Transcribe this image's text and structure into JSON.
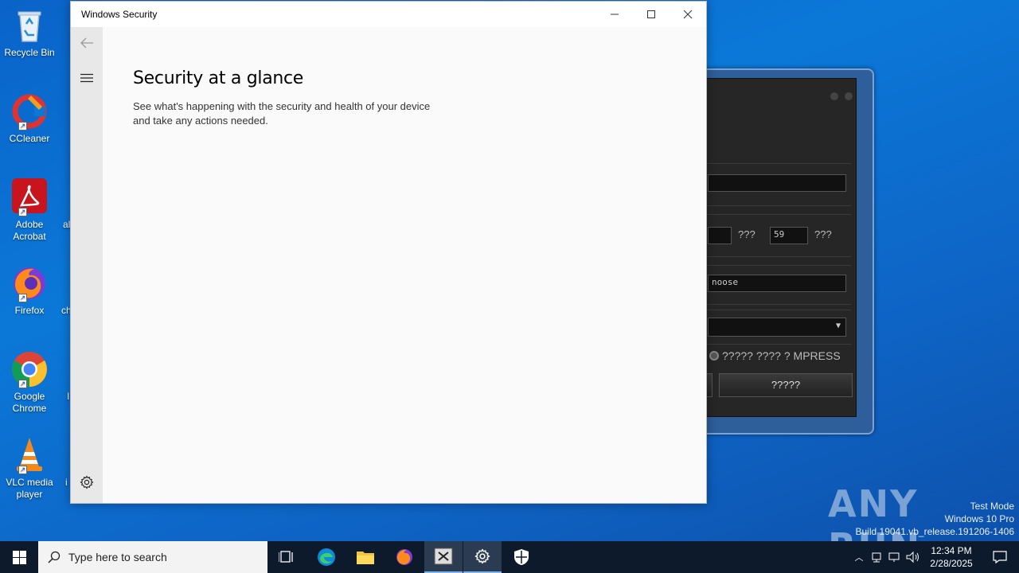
{
  "desktop": {
    "icons": [
      {
        "label": "Recycle Bin"
      },
      {
        "label": "CCleaner"
      },
      {
        "label": "Adobe Acrobat"
      },
      {
        "label": "Firefox"
      },
      {
        "label": "Google Chrome"
      },
      {
        "label": "VLC media player"
      }
    ],
    "partial_labels": [
      "al",
      "ch",
      "I",
      "i"
    ]
  },
  "window": {
    "title": "Windows Security",
    "heading": "Security at a glance",
    "description": "See what's happening with the security and health of your device and take any actions needed."
  },
  "background_app": {
    "field_value": "59",
    "unit_label_1": "???",
    "unit_label_2": "???",
    "choose_text": "noose",
    "radio_label": "????? ???? ? MPRESS",
    "button_label": "?????"
  },
  "taskbar": {
    "search_placeholder": "Type here to search",
    "time": "12:34 PM",
    "date": "2/28/2025"
  },
  "watermark": {
    "brand": "ANY RUN",
    "line1": "Test Mode",
    "line2": "Windows 10 Pro",
    "line3": "Build 19041.vb_release.191206-1406"
  }
}
